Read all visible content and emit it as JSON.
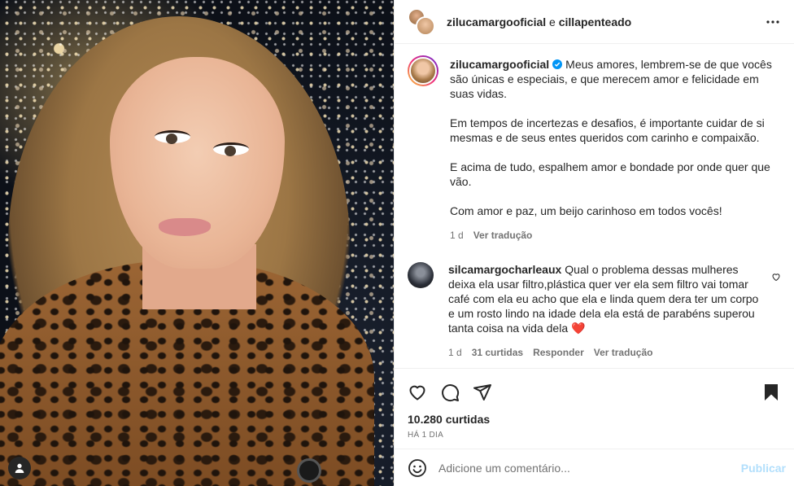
{
  "header": {
    "owner": "zilucamargooficial",
    "connector": " e ",
    "collab": "cillapenteado",
    "more_icon": "more-horizontal-icon"
  },
  "caption": {
    "username": "zilucamargooficial",
    "verified": true,
    "paragraphs": [
      "Meus amores, lembrem-se de que vocês são únicas e especiais, e que merecem amor e felicidade em suas vidas.",
      "Em tempos de incertezas e desafios, é importante cuidar de si mesmas e de seus entes queridos com carinho e compaixão.",
      "E acima de tudo, espalhem amor e bondade por onde quer que vão.",
      "Com amor e paz, um beijo carinhoso em todos vocês!"
    ],
    "time": "1 d",
    "translate": "Ver tradução"
  },
  "comment": {
    "username": "silcamargocharleaux",
    "text": "Qual o problema dessas mulheres deixa ela usar filtro,plástica quer ver ela sem filtro vai tomar café com ela eu acho que ela e linda quem dera ter um corpo e um rosto lindo na idade dela ela está de parabéns superou tanta coisa na vida dela",
    "emoji": "❤️",
    "time": "1 d",
    "likes": "31 curtidas",
    "reply": "Responder",
    "translate": "Ver tradução"
  },
  "actions": {
    "likes": "10.280 curtidas",
    "date": "Há 1 dia"
  },
  "add_comment": {
    "placeholder": "Adicione um comentário...",
    "post": "Publicar"
  },
  "colors": {
    "accent": "#0095f6",
    "post_disabled": "#b2dffc",
    "muted": "#737373",
    "verified": "#0095f6"
  }
}
